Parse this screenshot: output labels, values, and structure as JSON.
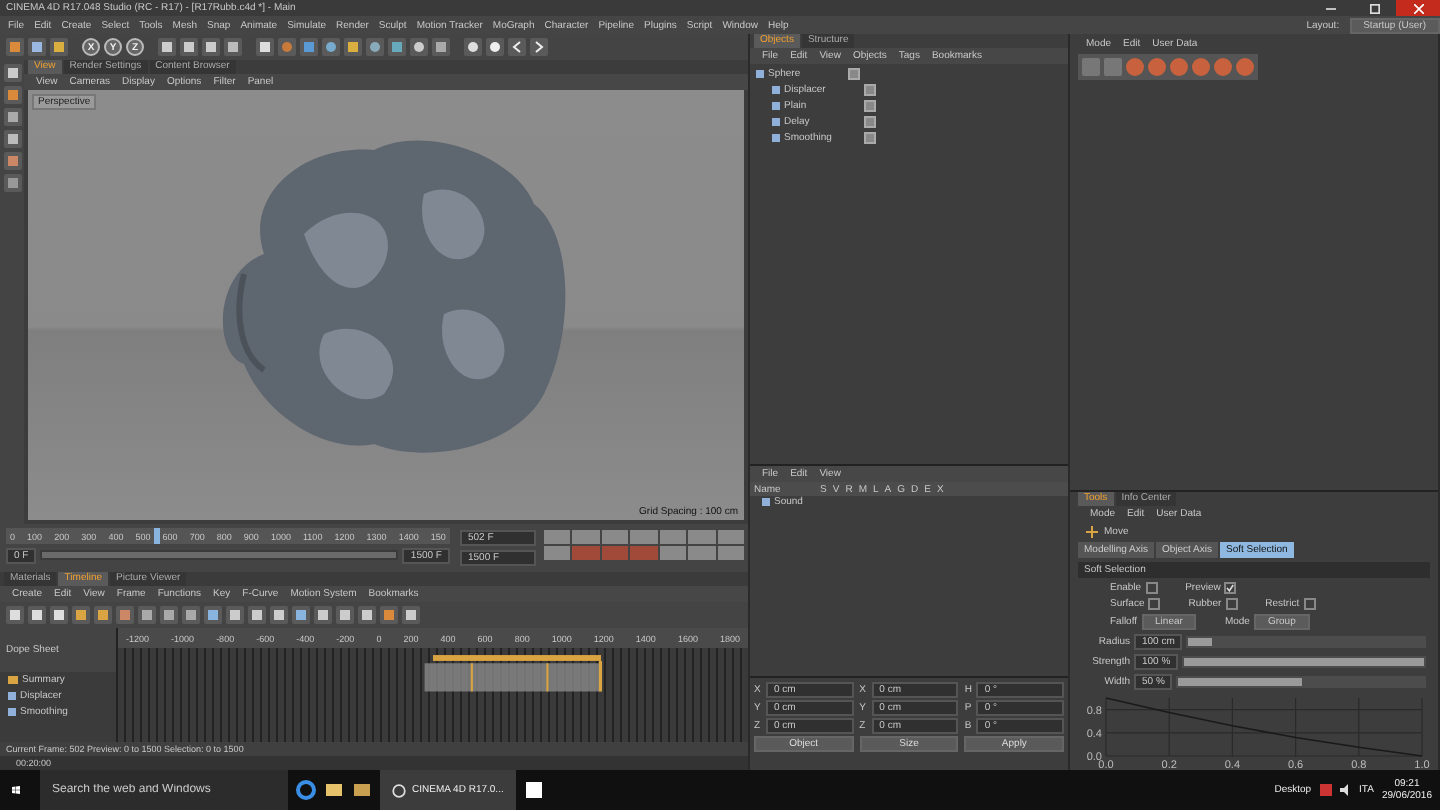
{
  "window": {
    "title": "CINEMA 4D R17.048 Studio (RC - R17) - [R17Rubb.c4d *] - Main"
  },
  "menu": [
    "File",
    "Edit",
    "Create",
    "Select",
    "Tools",
    "Mesh",
    "Snap",
    "Animate",
    "Simulate",
    "Render",
    "Sculpt",
    "Motion Tracker",
    "MoGraph",
    "Character",
    "Pipeline",
    "Plugins",
    "Script",
    "Window",
    "Help"
  ],
  "layout": {
    "label": "Layout:",
    "value": "Startup (User)"
  },
  "toolbar": {
    "axis_buttons": [
      "X",
      "Y",
      "Z"
    ]
  },
  "viewport": {
    "tabs": [
      {
        "label": "View",
        "selected": true
      },
      {
        "label": "Render Settings",
        "selected": false
      },
      {
        "label": "Content Browser",
        "selected": false
      }
    ],
    "menu": [
      "View",
      "Cameras",
      "Display",
      "Options",
      "Filter",
      "Panel"
    ],
    "camera": "Perspective",
    "grid_spacing": "Grid Spacing : 100 cm"
  },
  "ruler": {
    "ticks": [
      "0",
      "100",
      "200",
      "300",
      "400",
      "500",
      "600",
      "700",
      "800",
      "900",
      "1000",
      "1100",
      "1200",
      "1300",
      "1400",
      "150"
    ],
    "playhead": {
      "level": 0.335
    },
    "range": {
      "level": 1
    },
    "start": "0 F",
    "end": "1500 F",
    "current": "502 F",
    "max": "1500 F"
  },
  "timeline": {
    "tabs": [
      {
        "label": "Materials",
        "selected": false
      },
      {
        "label": "Timeline",
        "selected": true
      },
      {
        "label": "Picture Viewer",
        "selected": false
      }
    ],
    "menu": [
      "Create",
      "Edit",
      "View",
      "Frame",
      "Functions",
      "Key",
      "F-Curve",
      "Motion System",
      "Bookmarks"
    ],
    "mode": "Dope Sheet",
    "ticks": [
      "-1200",
      "-1000",
      "-800",
      "-600",
      "-400",
      "-200",
      "0",
      "200",
      "400",
      "600",
      "800",
      "1000",
      "1200",
      "1400",
      "1600",
      "1800"
    ],
    "tracks": [
      {
        "label": "Summary"
      },
      {
        "label": "Displacer"
      },
      {
        "label": "Smoothing"
      }
    ],
    "status": "Current Frame: 502  Preview: 0 to 1500  Selection: 0 to 1500",
    "time": "00:20:00"
  },
  "objects": {
    "tabs": [
      {
        "label": "Objects",
        "selected": true
      },
      {
        "label": "Structure",
        "selected": false
      }
    ],
    "menu": [
      "File",
      "Edit",
      "View",
      "Objects",
      "Tags",
      "Bookmarks"
    ],
    "tree": [
      {
        "name": "Sphere",
        "children": [
          {
            "name": "Displacer"
          },
          {
            "name": "Plain"
          },
          {
            "name": "Delay"
          },
          {
            "name": "Smoothing"
          }
        ]
      }
    ]
  },
  "attributes_top": {
    "menu": [
      "Mode",
      "Edit",
      "User Data"
    ]
  },
  "layers": {
    "menu": [
      "File",
      "Edit",
      "View"
    ],
    "columns": [
      "Name",
      "S",
      "V",
      "R",
      "M",
      "L",
      "A",
      "G",
      "D",
      "E",
      "X"
    ],
    "rows": [
      {
        "name": "Sound"
      }
    ]
  },
  "coordinates": {
    "fields": [
      {
        "axis": "X",
        "value": "0 cm"
      },
      {
        "axis": "X",
        "value": "0 cm"
      },
      {
        "axis": "H",
        "value": "0 °"
      },
      {
        "axis": "Y",
        "value": "0 cm"
      },
      {
        "axis": "Y",
        "value": "0 cm"
      },
      {
        "axis": "P",
        "value": "0 °"
      },
      {
        "axis": "Z",
        "value": "0 cm"
      },
      {
        "axis": "Z",
        "value": "0 cm"
      },
      {
        "axis": "B",
        "value": "0 °"
      }
    ],
    "dropdowns": [
      "Object",
      "Size"
    ],
    "button": "Apply"
  },
  "attributes": {
    "tabs": [
      {
        "label": "Tools",
        "selected": true
      },
      {
        "label": "Info Center",
        "selected": false
      }
    ],
    "menu": [
      "Mode",
      "Edit",
      "User Data"
    ],
    "tool": "Move",
    "subtabs": [
      {
        "label": "Modelling Axis",
        "selected": false
      },
      {
        "label": "Object Axis",
        "selected": false
      },
      {
        "label": "Soft Selection",
        "selected": true
      }
    ],
    "section": "Soft Selection",
    "checks": [
      {
        "label": "Enable",
        "checked": false
      },
      {
        "label": "Preview",
        "checked": true
      },
      {
        "label": "Surface",
        "checked": false
      },
      {
        "label": "Rubber",
        "checked": false
      },
      {
        "label": "Restrict",
        "checked": false
      }
    ],
    "dropdowns": [
      {
        "label": "Falloff",
        "value": "Linear"
      },
      {
        "label": "Mode",
        "value": "Group"
      }
    ],
    "sliders": [
      {
        "label": "Radius",
        "value": "100 cm",
        "level": 0.1
      },
      {
        "label": "Strength",
        "value": "100 %",
        "level": 1
      },
      {
        "label": "Width",
        "value": "50 %",
        "level": 0.5
      }
    ],
    "chart_data": {
      "type": "line",
      "x": [
        0,
        0.2,
        0.4,
        0.6,
        0.8,
        1.0
      ],
      "series": [
        {
          "color": "#1a1a1a",
          "values": [
            1,
            0.75,
            0.52,
            0.32,
            0.15,
            0
          ]
        }
      ],
      "xlim": [
        0,
        1
      ],
      "ylim": [
        0,
        1
      ],
      "grid": true,
      "xticks": [
        {
          "value": 0,
          "label": "0.0"
        },
        {
          "value": 0.2,
          "label": "0.2"
        },
        {
          "value": 0.4,
          "label": "0.4"
        },
        {
          "value": 0.6,
          "label": "0.6"
        },
        {
          "value": 0.8,
          "label": "0.8"
        },
        {
          "value": 1,
          "label": "1.0"
        }
      ],
      "yticks": [
        {
          "value": 0,
          "label": "0.0"
        },
        {
          "value": 0.4,
          "label": "0.4"
        },
        {
          "value": 0.8,
          "label": "0.8"
        }
      ]
    }
  },
  "taskbar": {
    "search": {
      "placeholder": "Search the web and Windows"
    },
    "app": "CINEMA 4D R17.0...",
    "desktop": "Desktop",
    "language": "ITA",
    "time": "09:21",
    "date": "29/06/2016"
  }
}
